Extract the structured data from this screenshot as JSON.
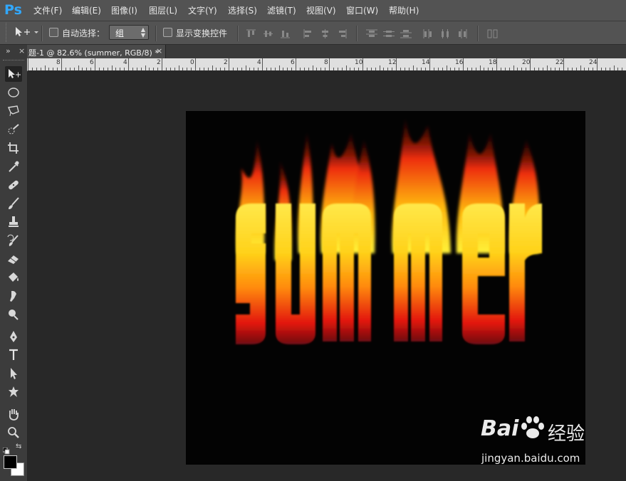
{
  "app": {
    "logo": "Ps",
    "accent": "#31a8ff"
  },
  "menu": [
    {
      "label": "文件(F)"
    },
    {
      "label": "编辑(E)"
    },
    {
      "label": "图像(I)"
    },
    {
      "label": "图层(L)"
    },
    {
      "label": "文字(Y)"
    },
    {
      "label": "选择(S)"
    },
    {
      "label": "滤镜(T)"
    },
    {
      "label": "视图(V)"
    },
    {
      "label": "窗口(W)"
    },
    {
      "label": "帮助(H)"
    }
  ],
  "options": {
    "tool_icon": "move-tool-icon",
    "auto_select_label": "自动选择：",
    "auto_select_checked": false,
    "auto_select_value": "组",
    "show_transform_label": "显示变换控件",
    "show_transform_checked": false
  },
  "document_tab": {
    "title": "题-1 @ 82.6% (summer, RGB/8) *",
    "close": "×"
  },
  "panel_header": {
    "collapse": "»",
    "close": "×"
  },
  "ruler": {
    "labels": [
      "8",
      "6",
      "4",
      "2",
      "0",
      "2",
      "4",
      "6",
      "8",
      "10",
      "12",
      "14",
      "16",
      "18",
      "20",
      "22",
      "24"
    ]
  },
  "canvas": {
    "text": "summer",
    "background": "#030303"
  },
  "watermark": {
    "brand_left": "Bai",
    "brand_right": "经验",
    "url": "jingyan.baidu.com"
  },
  "colors": {
    "foreground": "#000000",
    "background": "#ffffff"
  }
}
